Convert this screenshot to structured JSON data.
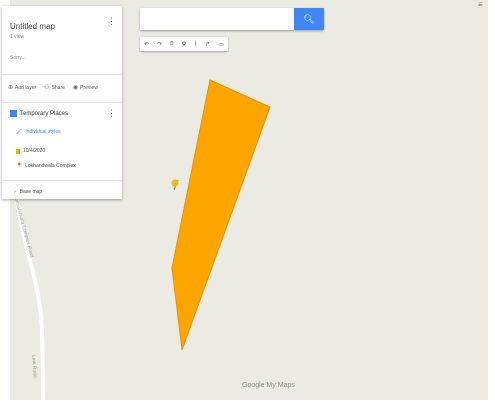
{
  "map_panel": {
    "title": "Untitled map",
    "subtitle": "1 view",
    "description": "Sorry..."
  },
  "actions": {
    "add_layer": "Add layer",
    "share": "Share",
    "preview": "Preview"
  },
  "layer": {
    "title": "Temporary Places",
    "style": "Individual styles",
    "items": [
      "10/4/2020",
      "Lokhandwala Complex"
    ]
  },
  "base_map": "Base map",
  "search": {
    "value": "",
    "placeholder": ""
  },
  "toolbar": {
    "icons": [
      "undo-icon",
      "redo-icon",
      "hand-icon",
      "marker-icon",
      "line-icon",
      "directions-icon",
      "ruler-icon"
    ]
  },
  "road_labels": [
    "Lokhandwala Complex Road",
    "Link Road"
  ],
  "footer": "Google My Maps",
  "colors": {
    "map_bg": "#ecebe3",
    "polygon": "#ffa500",
    "accent": "#4285f4",
    "pin": "#e8c200"
  }
}
